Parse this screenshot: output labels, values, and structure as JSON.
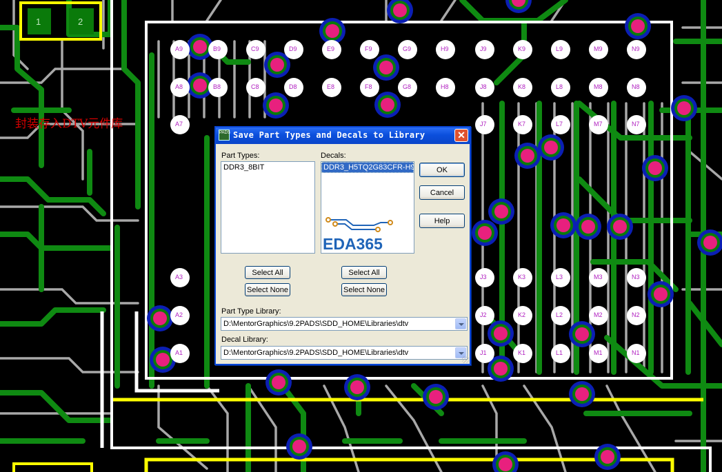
{
  "annotation": "封装存入DTV元件库",
  "pads_top_left": [
    "1",
    "2"
  ],
  "pins": [
    {
      "label": "A9",
      "r": 0,
      "c": 0
    },
    {
      "label": "B9",
      "r": 0,
      "c": 1
    },
    {
      "label": "C9",
      "r": 0,
      "c": 2
    },
    {
      "label": "D9",
      "r": 0,
      "c": 3
    },
    {
      "label": "E9",
      "r": 0,
      "c": 4
    },
    {
      "label": "F9",
      "r": 0,
      "c": 5
    },
    {
      "label": "G9",
      "r": 0,
      "c": 6
    },
    {
      "label": "H9",
      "r": 0,
      "c": 7
    },
    {
      "label": "J9",
      "r": 0,
      "c": 8
    },
    {
      "label": "K9",
      "r": 0,
      "c": 9
    },
    {
      "label": "L9",
      "r": 0,
      "c": 10
    },
    {
      "label": "M9",
      "r": 0,
      "c": 11
    },
    {
      "label": "N9",
      "r": 0,
      "c": 12
    },
    {
      "label": "A8",
      "r": 1,
      "c": 0
    },
    {
      "label": "B8",
      "r": 1,
      "c": 1
    },
    {
      "label": "C8",
      "r": 1,
      "c": 2
    },
    {
      "label": "D8",
      "r": 1,
      "c": 3
    },
    {
      "label": "E8",
      "r": 1,
      "c": 4
    },
    {
      "label": "F8",
      "r": 1,
      "c": 5
    },
    {
      "label": "G8",
      "r": 1,
      "c": 6
    },
    {
      "label": "H8",
      "r": 1,
      "c": 7
    },
    {
      "label": "J8",
      "r": 1,
      "c": 8
    },
    {
      "label": "K8",
      "r": 1,
      "c": 9
    },
    {
      "label": "L8",
      "r": 1,
      "c": 10
    },
    {
      "label": "M8",
      "r": 1,
      "c": 11
    },
    {
      "label": "N8",
      "r": 1,
      "c": 12
    },
    {
      "label": "A7",
      "r": 2,
      "c": 0
    },
    {
      "label": "J7",
      "r": 2,
      "c": 8
    },
    {
      "label": "K7",
      "r": 2,
      "c": 9
    },
    {
      "label": "L7",
      "r": 2,
      "c": 10
    },
    {
      "label": "M7",
      "r": 2,
      "c": 11
    },
    {
      "label": "N7",
      "r": 2,
      "c": 12
    },
    {
      "label": "A3",
      "r": 6,
      "c": 0
    },
    {
      "label": "J3",
      "r": 6,
      "c": 8
    },
    {
      "label": "K3",
      "r": 6,
      "c": 9
    },
    {
      "label": "L3",
      "r": 6,
      "c": 10
    },
    {
      "label": "M3",
      "r": 6,
      "c": 11
    },
    {
      "label": "N3",
      "r": 6,
      "c": 12
    },
    {
      "label": "A2",
      "r": 7,
      "c": 0
    },
    {
      "label": "J2",
      "r": 7,
      "c": 8
    },
    {
      "label": "K2",
      "r": 7,
      "c": 9
    },
    {
      "label": "L2",
      "r": 7,
      "c": 10
    },
    {
      "label": "M2",
      "r": 7,
      "c": 11
    },
    {
      "label": "N2",
      "r": 7,
      "c": 12
    },
    {
      "label": "A1",
      "r": 8,
      "c": 0
    },
    {
      "label": "J1",
      "r": 8,
      "c": 8
    },
    {
      "label": "K1",
      "r": 8,
      "c": 9
    },
    {
      "label": "L1",
      "r": 8,
      "c": 10
    },
    {
      "label": "M1",
      "r": 8,
      "c": 11
    },
    {
      "label": "N1",
      "r": 8,
      "c": 12
    }
  ],
  "dialog": {
    "title": "Save Part Types and Decals to Library",
    "icon_text": "PADS",
    "close_glyph": "✕",
    "part_types_label": "Part Types:",
    "decals_label": "Decals:",
    "part_types": [
      "DDR3_8BIT"
    ],
    "decals": [
      "DDR3_H5TQ2G83CFR-H9"
    ],
    "buttons": {
      "ok": "OK",
      "cancel": "Cancel",
      "help": "Help",
      "select_all_parts": "Select All",
      "select_none_parts": "Select None",
      "select_all_decals": "Select All",
      "select_none_decals": "Select None"
    },
    "part_type_library_label": "Part Type Library:",
    "part_type_library_value": "D:\\MentorGraphics\\9.2PADS\\SDD_HOME\\Libraries\\dtv",
    "decal_library_label": "Decal Library:",
    "decal_library_value": "D:\\MentorGraphics\\9.2PADS\\SDD_HOME\\Libraries\\dtv",
    "watermark": "EDA365"
  },
  "colors": {
    "trace_green": "#0f8a12",
    "trace_gray": "#a8a8a8",
    "via_pink": "#e8207e",
    "outline_white": "#ffffff",
    "outline_yellow": "#ffff00",
    "xp_blue": "#0a47d6"
  }
}
